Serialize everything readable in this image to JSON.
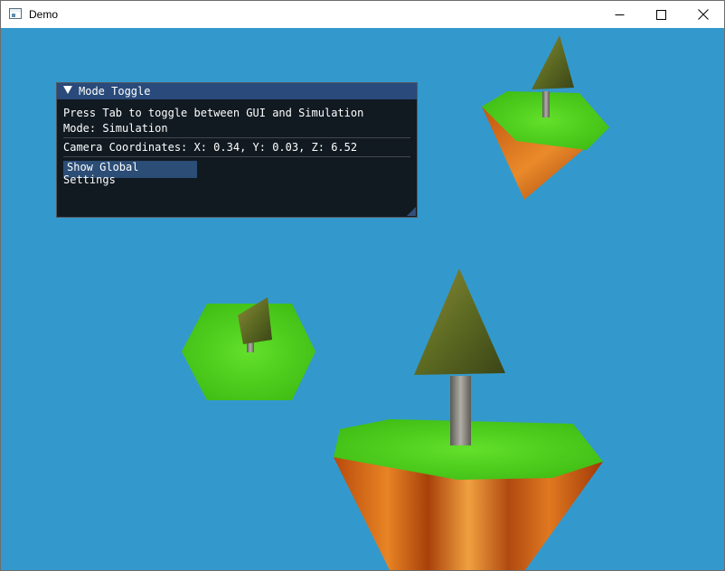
{
  "window": {
    "title": "Demo",
    "controls": [
      "minimize-icon",
      "maximize-icon",
      "close-icon"
    ]
  },
  "scene": {
    "sky_color": "#3399cc",
    "objects": [
      "floating-island",
      "floating-island",
      "floating-island"
    ]
  },
  "gui": {
    "title": "Mode Toggle",
    "instruction": "Press Tab to toggle between GUI and Simulation",
    "mode_line": "Mode: Simulation",
    "camera_line": "Camera Coordinates: X: 0.34, Y: 0.03, Z: 6.52",
    "show_settings_button": "Show Global Settings"
  }
}
